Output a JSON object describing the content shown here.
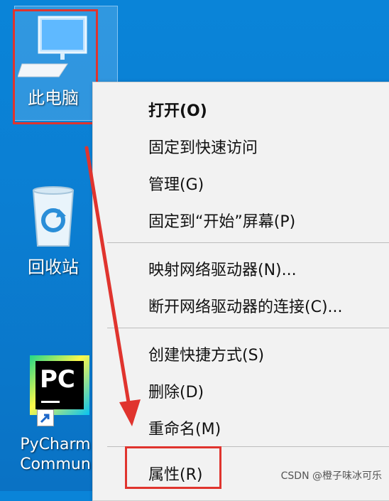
{
  "desktop": {
    "icons": [
      {
        "label": "此电脑",
        "icon": "computer-icon"
      },
      {
        "label": "回收站",
        "icon": "recycle-bin-icon"
      },
      {
        "label_lines": [
          "PyCharm",
          "Commun"
        ],
        "icon": "pycharm-icon",
        "badge": "PC"
      }
    ]
  },
  "context_menu": {
    "groups": [
      [
        "打开(O)",
        "固定到快速访问",
        "管理(G)",
        "固定到“开始”屏幕(P)"
      ],
      [
        "映射网络驱动器(N)...",
        "断开网络驱动器的连接(C)..."
      ],
      [
        "创建快捷方式(S)",
        "删除(D)",
        "重命名(M)"
      ],
      [
        "属性(R)"
      ]
    ]
  },
  "annotations": {
    "highlight_color": "#e0342e"
  },
  "watermark": "CSDN @橙子味冰可乐"
}
